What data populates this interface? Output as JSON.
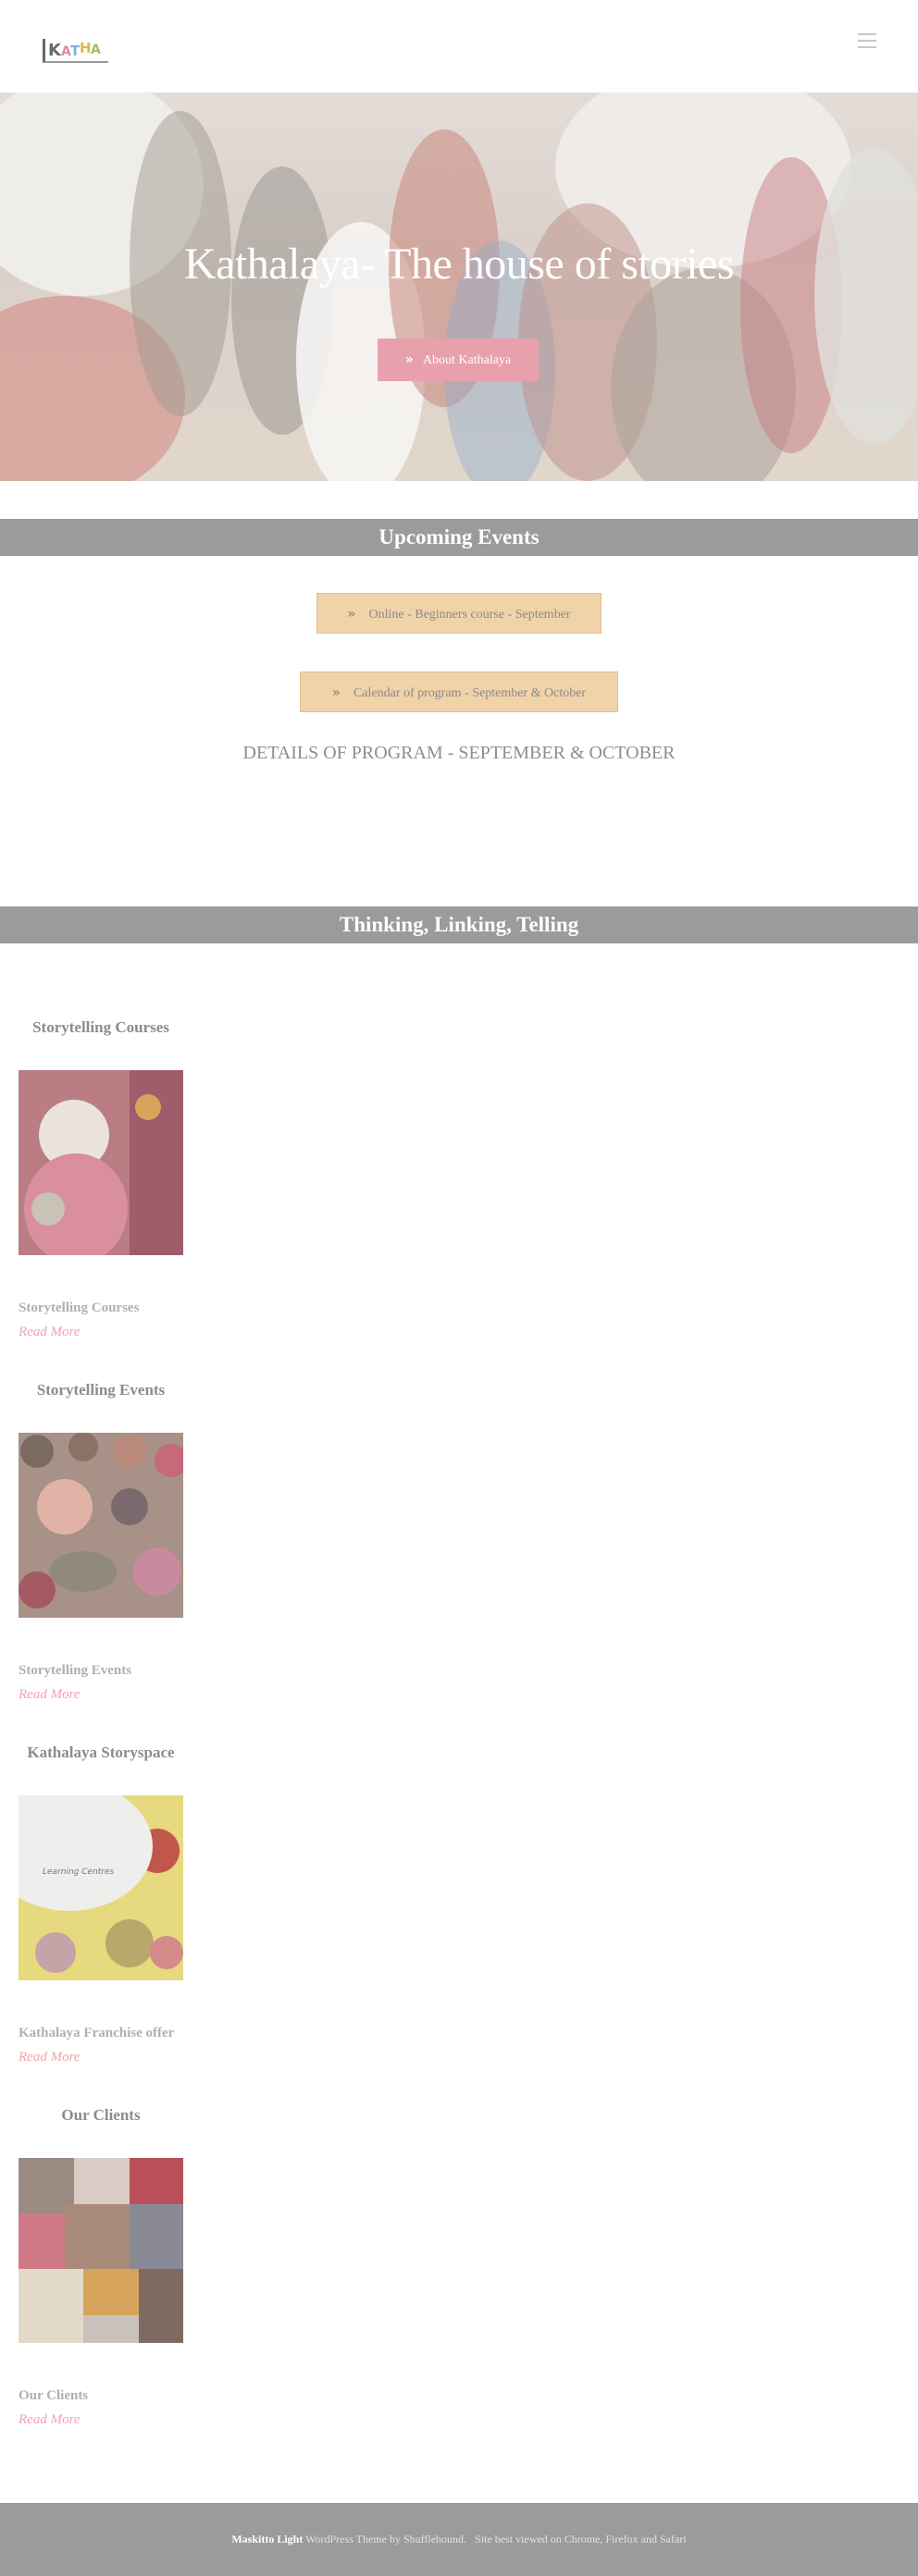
{
  "header": {
    "logo_text": "KATHALAYA",
    "menu_icon": "hamburger-icon"
  },
  "hero": {
    "title": "Kathalaya- The house of stories",
    "button_label": "About Kathalaya",
    "button_icon": "double-chevron-right-icon"
  },
  "upcoming": {
    "heading": "Upcoming Events",
    "buttons": [
      {
        "label": "Online - Beginners course - September"
      },
      {
        "label": "Calendar of program - September & October"
      }
    ],
    "details_text": "DETAILS OF PROGRAM - SEPTEMBER & OCTOBER"
  },
  "thinking": {
    "heading": "Thinking, Linking, Telling",
    "cards": [
      {
        "title": "Storytelling Courses",
        "caption": "Storytelling Courses",
        "read_more": "Read More"
      },
      {
        "title": "Storytelling Events",
        "caption": "Storytelling Events",
        "read_more": "Read More"
      },
      {
        "title": "Kathalaya Storyspace",
        "caption": "Kathalaya Franchise offer",
        "read_more": "Read More",
        "image_text": "Learning Centres"
      },
      {
        "title": "Our Clients",
        "caption": "Our Clients",
        "read_more": "Read More"
      }
    ]
  },
  "footer": {
    "theme_name": "Maskitto Light",
    "theme_credit": "WordPress Theme by Shufflehound.",
    "best_viewed": "Site best viewed on Chrome, Firefox and Safari"
  },
  "colors": {
    "accent_pink": "#e8a0ad",
    "event_button": "#f0d3a8",
    "section_bar": "#9b9b9b",
    "read_more": "#f0a3ad"
  }
}
